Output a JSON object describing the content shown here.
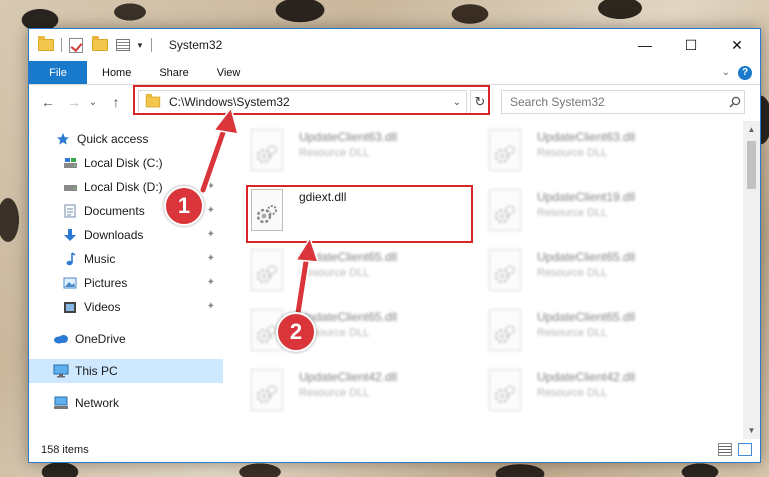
{
  "window": {
    "title": "System32",
    "controls": {
      "minimize": "—",
      "maximize": "☐",
      "close": "✕"
    }
  },
  "ribbon": {
    "file": "File",
    "tabs": [
      "Home",
      "Share",
      "View"
    ],
    "collapse": "⌄",
    "help": "?"
  },
  "nav": {
    "back": "←",
    "forward": "→",
    "recent": "⌄",
    "up": "↑",
    "address": "C:\\Windows\\System32",
    "address_dropdown": "⌄",
    "refresh": "↻",
    "search_placeholder": "Search System32"
  },
  "sidebar": {
    "items": [
      {
        "label": "Quick access",
        "icon": "star-icon",
        "pinned": false
      },
      {
        "label": "Local Disk (C:)",
        "icon": "drive-c-icon",
        "pinned": true
      },
      {
        "label": "Local Disk (D:)",
        "icon": "drive-d-icon",
        "pinned": true
      },
      {
        "label": "Documents",
        "icon": "documents-icon",
        "pinned": true
      },
      {
        "label": "Downloads",
        "icon": "downloads-icon",
        "pinned": true
      },
      {
        "label": "Music",
        "icon": "music-icon",
        "pinned": true
      },
      {
        "label": "Pictures",
        "icon": "pictures-icon",
        "pinned": true
      },
      {
        "label": "Videos",
        "icon": "videos-icon",
        "pinned": true
      },
      {
        "label": "OneDrive",
        "icon": "onedrive-icon",
        "pinned": false
      },
      {
        "label": "This PC",
        "icon": "this-pc-icon",
        "pinned": false
      },
      {
        "label": "Network",
        "icon": "network-icon",
        "pinned": false
      }
    ],
    "pin_glyph": "📌"
  },
  "files": [
    {
      "name": "UpdateClient63.dll",
      "type": "Resource DLL",
      "highlighted": false
    },
    {
      "name": "UpdateClient63.dll",
      "type": "Resource DLL",
      "highlighted": false
    },
    {
      "name": "gdiext.dll",
      "type": "",
      "highlighted": true
    },
    {
      "name": "UpdateClient19.dll",
      "type": "Resource DLL",
      "highlighted": false
    },
    {
      "name": "UpdateClient65.dll",
      "type": "Resource DLL",
      "highlighted": false
    },
    {
      "name": "UpdateClient65.dll",
      "type": "Resource DLL",
      "highlighted": false
    },
    {
      "name": "UpdateClient65.dll",
      "type": "Resource DLL",
      "highlighted": false
    },
    {
      "name": "UpdateClient65.dll",
      "type": "Resource DLL",
      "highlighted": false
    },
    {
      "name": "UpdateClient42.dll",
      "type": "Resource DLL",
      "highlighted": false
    },
    {
      "name": "UpdateClient42.dll",
      "type": "Resource DLL",
      "highlighted": false
    }
  ],
  "scrollbar": {
    "up": "▲",
    "down": "▼"
  },
  "status": {
    "item_count": "158 items"
  },
  "callouts": {
    "one": "1",
    "two": "2"
  },
  "colors": {
    "accent": "#1979ca",
    "highlight": "#d9252a",
    "callout": "#d9353a",
    "selected": "#cde8ff"
  }
}
